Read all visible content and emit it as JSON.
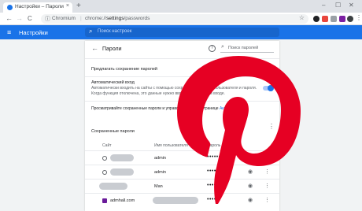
{
  "browser": {
    "tab_title": "Настройки – Пароли",
    "tab_close": "×",
    "new_tab": "+",
    "win_min": "–",
    "win_max": "☐",
    "win_close": "✕",
    "back": "←",
    "forward": "→",
    "reload": "C",
    "info": "ⓘ",
    "host": "Chromium",
    "url_prefix": "chrome://",
    "url_bold": "settings",
    "url_suffix": "/passwords",
    "star": "☆",
    "menu": "⋮"
  },
  "header": {
    "menu": "≡",
    "title": "Настройки",
    "search_icon": "⌕",
    "search_placeholder": "Поиск настроек"
  },
  "passwords_page": {
    "back": "←",
    "title": "Пароли",
    "help": "?",
    "search_icon": "⌕",
    "search_placeholder": "Поиск паролей",
    "offer_save_label": "Предлагать сохранение паролей",
    "auto_signin_label": "Автоматический вход",
    "auto_signin_sub1": "Автоматически входить на сайты с помощью сохраненного имени пользователя и пароля.",
    "auto_signin_sub2": "Когда функция отключена, это данные нужно вводить при каждом входе.",
    "manage_text": "Просматривайте сохраненные пароли и управляйте ими на странице",
    "manage_link": "Аккаунт Google",
    "saved_title": "Сохраненные пароли",
    "col_site": "Сайт",
    "col_user": "Имя пользователя",
    "col_password": "Пароль",
    "kebab": "⋮",
    "eye": "◉",
    "rows": [
      {
        "site": "",
        "user": "admin",
        "password": "••••••"
      },
      {
        "site": "",
        "user": "admin",
        "password": "••••••"
      },
      {
        "site": "",
        "user": "Man",
        "password": "••••••"
      },
      {
        "site": "admhall.com",
        "user": "",
        "password": "••••••"
      }
    ]
  },
  "colors": {
    "accent": "#1a73e8",
    "pin_red": "#e60023"
  },
  "icons": [
    "red-pin-logo"
  ]
}
